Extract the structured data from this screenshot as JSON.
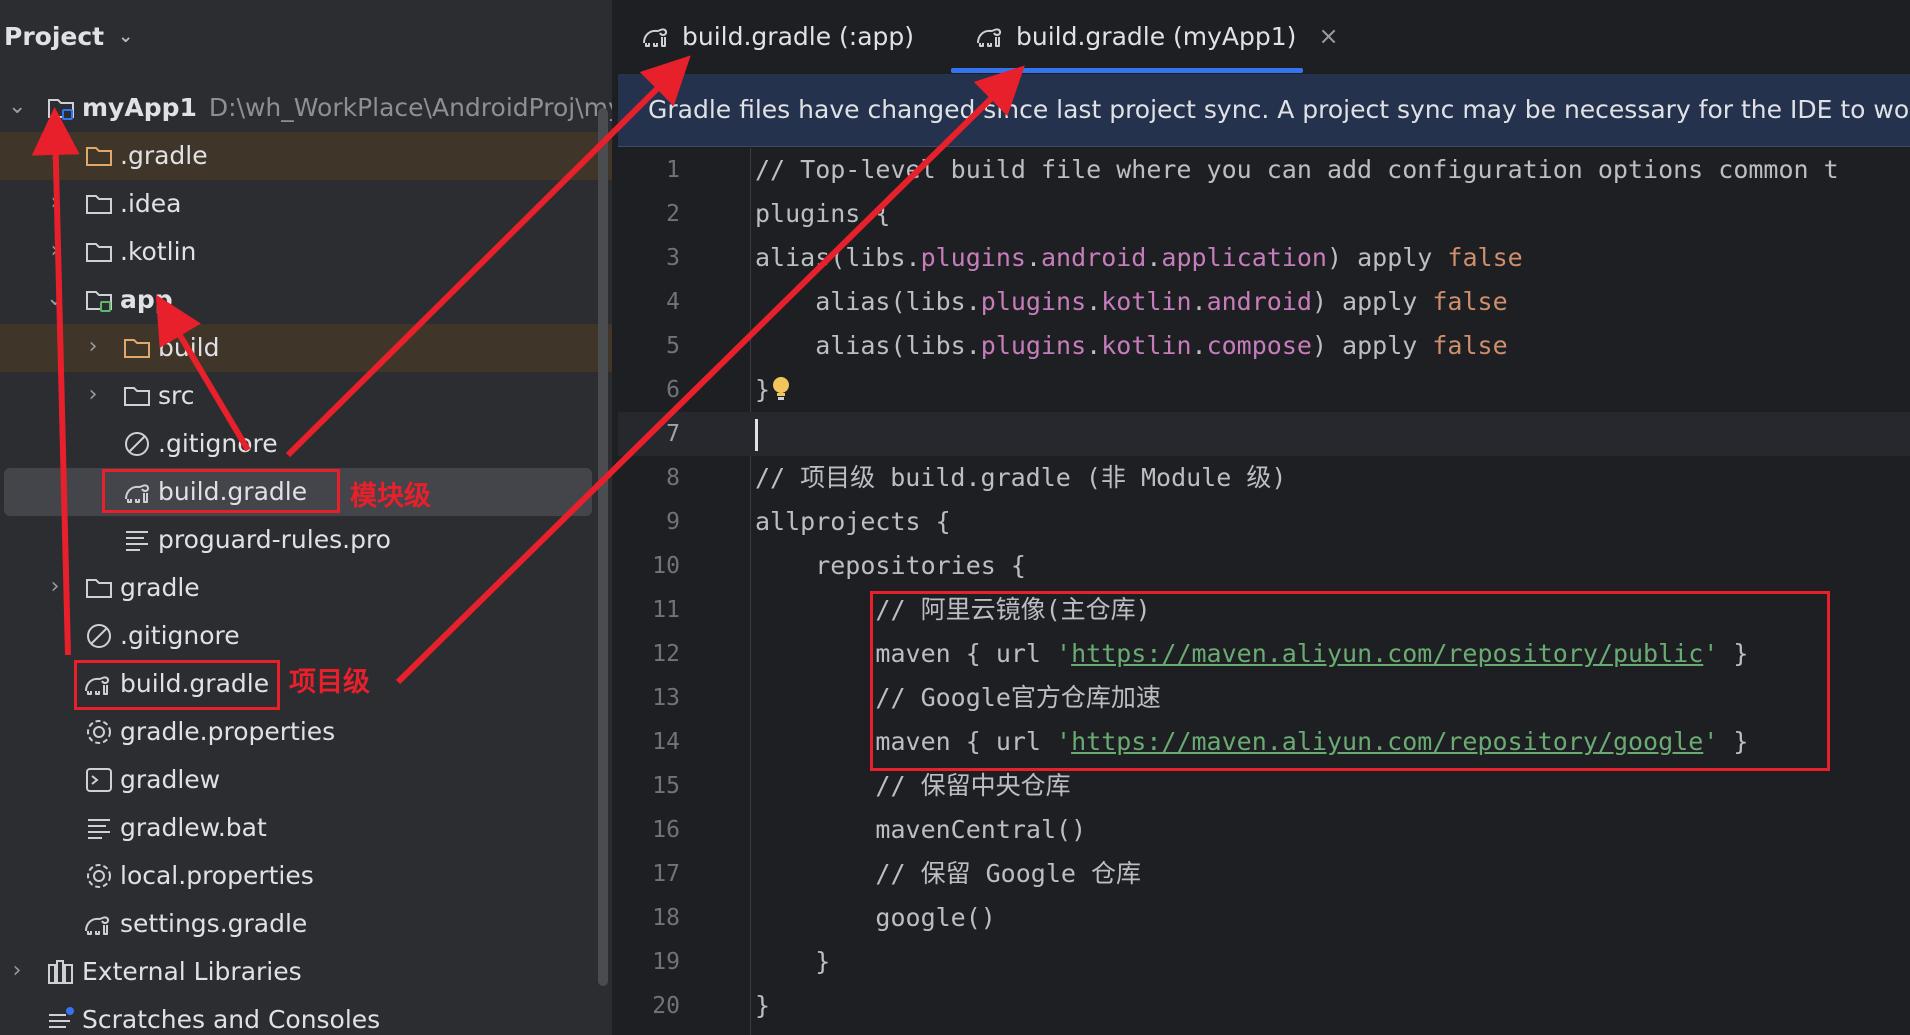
{
  "sidebar": {
    "title": "Project",
    "chevron_icon": "chevron-down-icon",
    "root": {
      "name": "myApp1",
      "path": "D:\\wh_WorkPlace\\AndroidProj\\myAp"
    },
    "items": [
      {
        "label": ".gradle",
        "icon": "folder-orange-icon",
        "expanded": false
      },
      {
        "label": ".idea",
        "icon": "folder-icon",
        "expanded": false
      },
      {
        "label": ".kotlin",
        "icon": "folder-icon",
        "expanded": false
      },
      {
        "label": "app",
        "icon": "module-folder-icon",
        "expanded": true
      },
      {
        "label": "build",
        "icon": "folder-orange-icon",
        "expanded": false
      },
      {
        "label": "src",
        "icon": "folder-icon",
        "expanded": false
      },
      {
        "label": ".gitignore",
        "icon": "ignore-icon"
      },
      {
        "label": "build.gradle",
        "icon": "gradle-icon"
      },
      {
        "label": "proguard-rules.pro",
        "icon": "text-file-icon"
      },
      {
        "label": "gradle",
        "icon": "folder-icon",
        "expanded": false
      },
      {
        "label": ".gitignore",
        "icon": "ignore-icon"
      },
      {
        "label": "build.gradle",
        "icon": "gradle-icon"
      },
      {
        "label": "gradle.properties",
        "icon": "gear-icon"
      },
      {
        "label": "gradlew",
        "icon": "terminal-icon"
      },
      {
        "label": "gradlew.bat",
        "icon": "text-file-icon"
      },
      {
        "label": "local.properties",
        "icon": "gear-icon"
      },
      {
        "label": "settings.gradle",
        "icon": "gradle-icon"
      },
      {
        "label": "External Libraries",
        "icon": "library-icon",
        "expanded": false
      },
      {
        "label": "Scratches and Consoles",
        "icon": "scratches-icon"
      }
    ]
  },
  "annotations": {
    "module_level": "模块级",
    "project_level": "项目级",
    "color": "#e8202b"
  },
  "tabs": [
    {
      "label": "build.gradle (:app)",
      "active": false
    },
    {
      "label": "build.gradle (myApp1)",
      "active": true,
      "close": "×"
    }
  ],
  "banner": "Gradle files have changed since last project sync. A project sync may be necessary for the IDE to work properly.",
  "code": {
    "line_numbers": [
      "1",
      "2",
      "3",
      "4",
      "5",
      "6",
      "7",
      "8",
      "9",
      "10",
      "11",
      "12",
      "13",
      "14",
      "15",
      "16",
      "17",
      "18",
      "19",
      "20"
    ],
    "l1": "// Top-level build file where you can add configuration options common t",
    "l2": "plugins {",
    "l3_a": "alias(libs.",
    "l3_b": "plugins",
    "l3_c": ".",
    "l3_d": "android",
    "l3_e": ".",
    "l3_f": "application",
    "l3_g": ") apply ",
    "l3_h": "false",
    "l4_a": "    alias(libs.",
    "l4_b": "plugins",
    "l4_c": ".",
    "l4_d": "kotlin",
    "l4_e": ".",
    "l4_f": "android",
    "l4_g": ") apply ",
    "l4_h": "false",
    "l5_a": "    alias(libs.",
    "l5_b": "plugins",
    "l5_c": ".",
    "l5_d": "kotlin",
    "l5_e": ".",
    "l5_f": "compose",
    "l5_g": ") apply ",
    "l5_h": "false",
    "l6": "}",
    "l8": "// 项目级 build.gradle (非 Module 级)",
    "l9": "allprojects {",
    "l10": "    repositories {",
    "l11": "        // 阿里云镜像(主仓库)",
    "l12_a": "        maven { url ",
    "l12_q1": "'",
    "l12_url": "https://maven.aliyun.com/repository/public",
    "l12_q2": "'",
    "l12_b": " }",
    "l13": "        // Google官方仓库加速",
    "l14_a": "        maven { url ",
    "l14_q1": "'",
    "l14_url": "https://maven.aliyun.com/repository/google",
    "l14_q2": "'",
    "l14_b": " }",
    "l15": "        // 保留中央仓库",
    "l16": "        mavenCentral()",
    "l17": "        // 保留 Google 仓库",
    "l18": "        google()",
    "l19": "    }",
    "l20": "}"
  }
}
